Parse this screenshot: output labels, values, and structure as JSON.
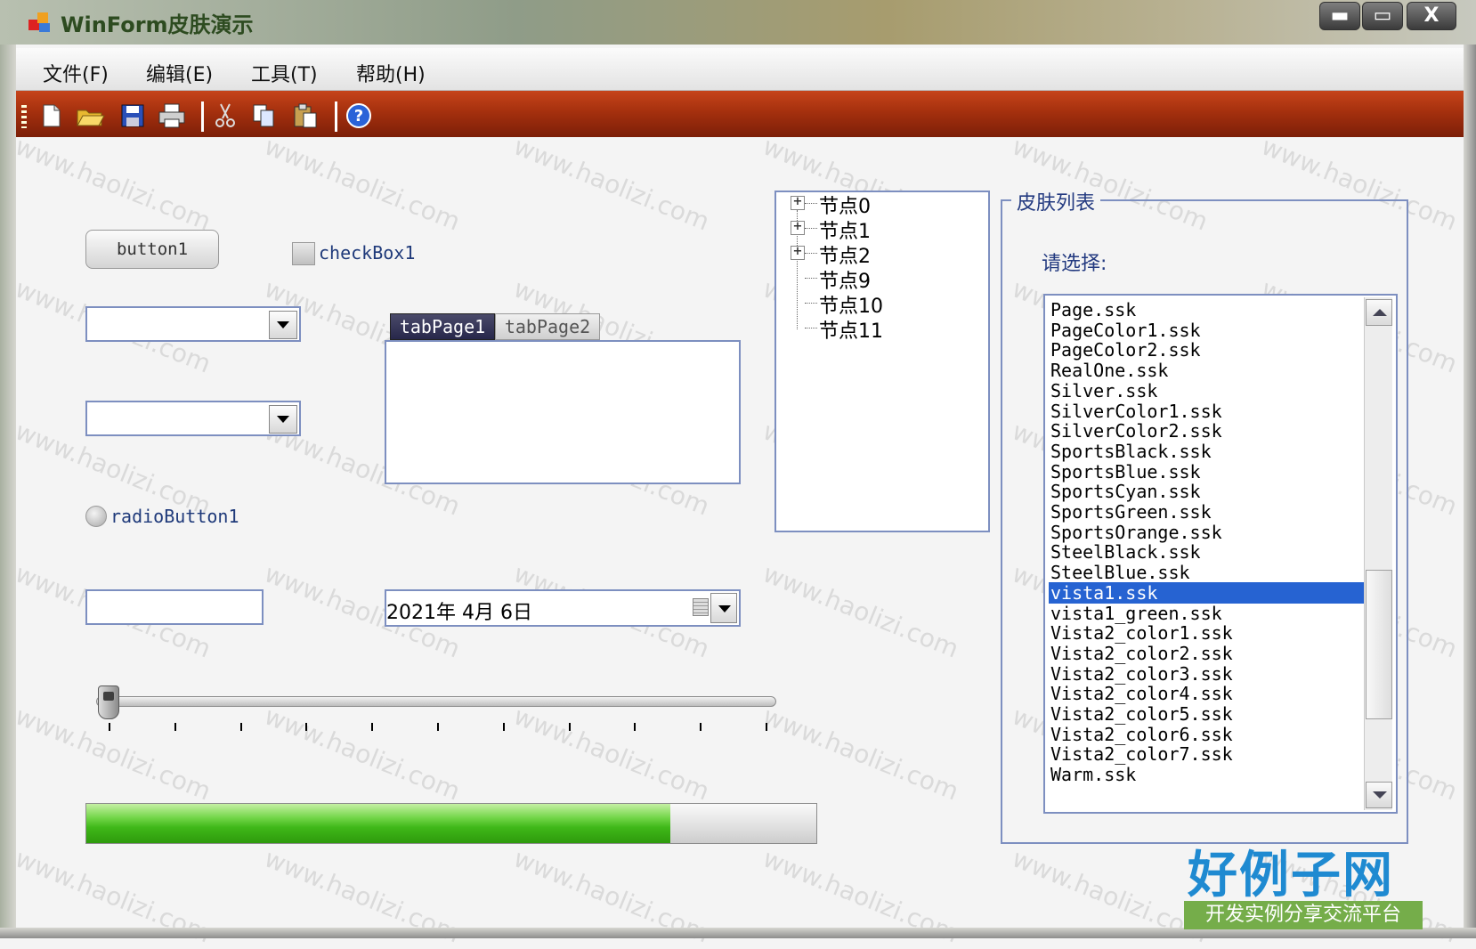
{
  "window": {
    "title": "WinForm皮肤演示",
    "minimize_glyph": "▬",
    "maximize_glyph": "▭",
    "close_glyph": "X"
  },
  "menu": [
    {
      "label": "文件(F)"
    },
    {
      "label": "编辑(E)"
    },
    {
      "label": "工具(T)"
    },
    {
      "label": "帮助(H)"
    }
  ],
  "toolbar": {
    "icons": [
      "new-file-icon",
      "open-folder-icon",
      "save-icon",
      "print-icon",
      "cut-icon",
      "copy-icon",
      "paste-icon",
      "help-icon"
    ]
  },
  "controls": {
    "button1": "button1",
    "checkbox1": {
      "label": "checkBox1",
      "checked": false
    },
    "combobox1": {
      "value": ""
    },
    "combobox2": {
      "value": ""
    },
    "radio1": {
      "label": "radioButton1",
      "checked": false
    },
    "textbox1": {
      "value": ""
    },
    "tabs": [
      {
        "label": "tabPage1",
        "active": true
      },
      {
        "label": "tabPage2",
        "active": false
      }
    ],
    "date_value": "2021年  4月  6日",
    "trackbar": {
      "value": 0,
      "ticks": 11
    },
    "progress": {
      "fraction": 0.8
    }
  },
  "tree": [
    {
      "label": "节点0",
      "expandable": true
    },
    {
      "label": "节点1",
      "expandable": true
    },
    {
      "label": "节点2",
      "expandable": true
    },
    {
      "label": "节点9",
      "expandable": false
    },
    {
      "label": "节点10",
      "expandable": false
    },
    {
      "label": "节点11",
      "expandable": false
    }
  ],
  "skin_group": {
    "title": "皮肤列表",
    "prompt": "请选择:",
    "selected": "vista1.ssk",
    "items": [
      "Page.ssk",
      "PageColor1.ssk",
      "PageColor2.ssk",
      "RealOne.ssk",
      "Silver.ssk",
      "SilverColor1.ssk",
      "SilverColor2.ssk",
      "SportsBlack.ssk",
      "SportsBlue.ssk",
      "SportsCyan.ssk",
      "SportsGreen.ssk",
      "SportsOrange.ssk",
      "SteelBlack.ssk",
      "SteelBlue.ssk",
      "vista1.ssk",
      "vista1_green.ssk",
      "Vista2_color1.ssk",
      "Vista2_color2.ssk",
      "Vista2_color3.ssk",
      "Vista2_color4.ssk",
      "Vista2_color5.ssk",
      "Vista2_color6.ssk",
      "Vista2_color7.ssk",
      "Warm.ssk"
    ]
  },
  "watermark": "www.haolizi.com",
  "logo": {
    "main": "好例子网",
    "sub": "开发实例分享交流平台"
  },
  "colors": {
    "toolbar": "#a5300e",
    "selection": "#2663d2",
    "progress": "#3fb819",
    "border": "#7d8fc0"
  }
}
